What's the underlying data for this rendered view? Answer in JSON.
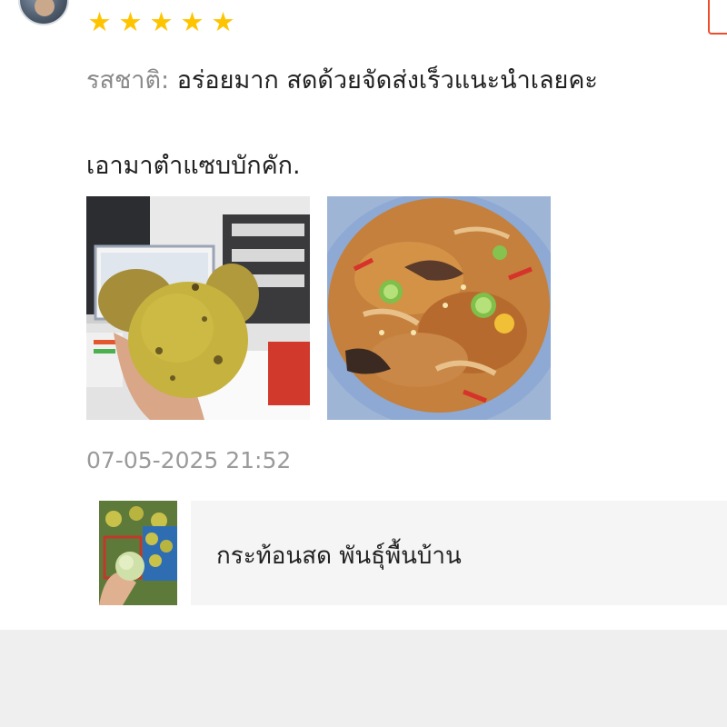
{
  "review": {
    "rating": 5,
    "rating_max": 5,
    "taste_label": "รสชาติ:",
    "taste_text": "อร่อยมาก สดด้วยจัดส่งเร็วแนะนำเลยคะ",
    "comment": "เอามาตำแซบบักคัก.",
    "photos": [
      "santol-fruit-photo",
      "spicy-santol-salad-photo"
    ],
    "timestamp": "07-05-2025 21:52"
  },
  "product": {
    "name": "กระท้อนสด พันธุ์พื้นบ้าน"
  },
  "colors": {
    "star": "#ffc400",
    "accent": "#ee4d2d",
    "muted_text": "#8a8a8a",
    "product_bg": "#f5f5f5"
  }
}
